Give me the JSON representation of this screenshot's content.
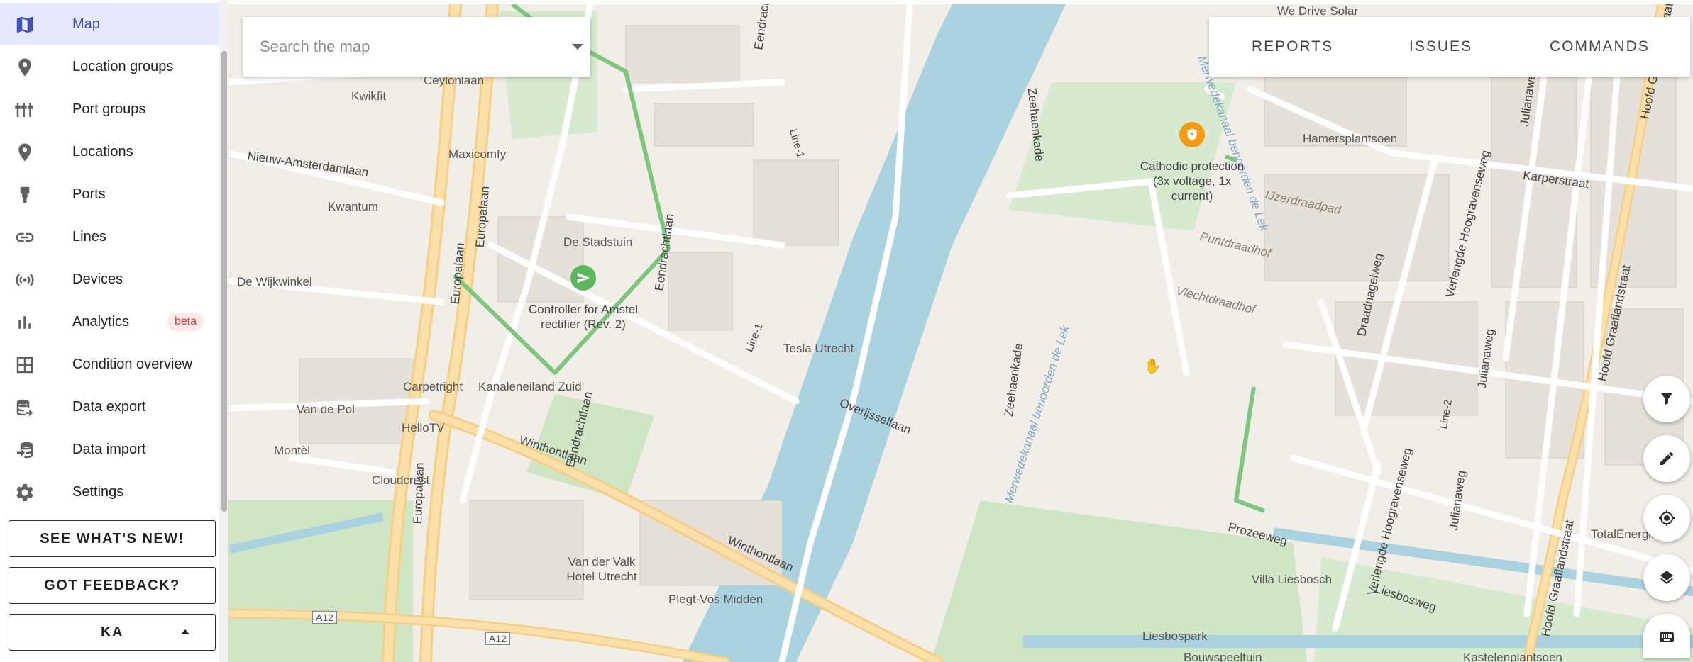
{
  "sidebar": {
    "items": [
      {
        "label": "Map",
        "icon": "map-icon",
        "active": true
      },
      {
        "label": "Location groups",
        "icon": "location-group-icon"
      },
      {
        "label": "Port groups",
        "icon": "port-group-icon"
      },
      {
        "label": "Locations",
        "icon": "location-pin-icon"
      },
      {
        "label": "Ports",
        "icon": "port-icon"
      },
      {
        "label": "Lines",
        "icon": "link-icon"
      },
      {
        "label": "Devices",
        "icon": "broadcast-icon"
      },
      {
        "label": "Analytics",
        "icon": "bar-chart-icon",
        "badge": "beta"
      },
      {
        "label": "Condition overview",
        "icon": "table-grid-icon"
      },
      {
        "label": "Data export",
        "icon": "database-export-icon"
      },
      {
        "label": "Data import",
        "icon": "database-import-icon"
      },
      {
        "label": "Settings",
        "icon": "gear-icon"
      }
    ],
    "whats_new_label": "SEE WHAT'S NEW!",
    "feedback_label": "GOT FEEDBACK?",
    "user_label": "KA"
  },
  "search": {
    "placeholder": "Search the map"
  },
  "top_tabs": [
    "REPORTS",
    "ISSUES",
    "COMMANDS"
  ],
  "fabs": [
    "filter-icon",
    "pencil-icon",
    "my-location-icon",
    "layers-icon",
    "keyboard-icon"
  ],
  "markers": {
    "controller": "Controller for Amstel rectifier (Rev. 2)",
    "cathodic": "Cathodic protection (3x voltage, 1x current)"
  },
  "map_labels": {
    "we_drive_solar": "We Drive Solar",
    "ceylonlaan": "Ceylonlaan",
    "kwikfit": "Kwikfit",
    "maxicomfy": "Maxicomfy",
    "nieuw_amsterdamlaan": "Nieuw-Amsterdamlaan",
    "kwantum": "Kwantum",
    "de_stadstuin": "De Stadstuin",
    "de_wijkwinkel": "De Wijkwinkel",
    "europalaan": "Europalaan",
    "eendrachtlaan": "Eendrachtlaan",
    "line1": "Line-1",
    "line2": "Line-2",
    "tesla_utrecht": "Tesla Utrecht",
    "carpetright": "Carpetright",
    "kanaleneiland_zuid": "Kanaleneiland Zuid",
    "van_de_pol": "Van de Pol",
    "hellotv": "HelloTV",
    "montel": "Montèl",
    "cloudcrest": "Cloudcrest",
    "winthontlaan": "Winthontlaan",
    "overijssellaan": "Overijssellaan",
    "zeehaenkade": "Zeehaenkade",
    "merwedekanaal": "Merwedekanaal benoorden de Lek",
    "van_der_valk": "Van der Valk Hotel Utrecht",
    "plegt_vos": "Plegt-Vos Midden",
    "a12": "A12",
    "hamersplantsoen": "Hamersplantsoen",
    "ijzerdraadpad": "IJzerdraadpad",
    "puntdraadhof": "Puntdraadhof",
    "vlechtdraadhof": "Vlechtdraadhof",
    "draadnagelweg": "Draadnagelweg",
    "verlengde_hoogravenseweg": "Verlengde Hoogravenseweg",
    "julianaweg": "Julianaweg",
    "hoofd_graaflandstraat": "Hoofd Graaflandstraat",
    "karperstraat": "Karperstraat",
    "prozeeweg": "Prozeeweg",
    "liesbosweg": "Liesbosweg",
    "villa_liesbosch": "Villa Liesbosch",
    "liesbospark": "Liesbospark",
    "total_energies": "TotalEnergies",
    "bouwspeeltuin": "Bouwspeeltuin",
    "kastelenplantsoen": "Kastelenplantsoen"
  },
  "colors": {
    "accent": "#3f51b5",
    "line": "#7cc67e",
    "marker_green": "#5cb85c",
    "marker_orange": "#f39c12",
    "water": "#aad3df"
  }
}
